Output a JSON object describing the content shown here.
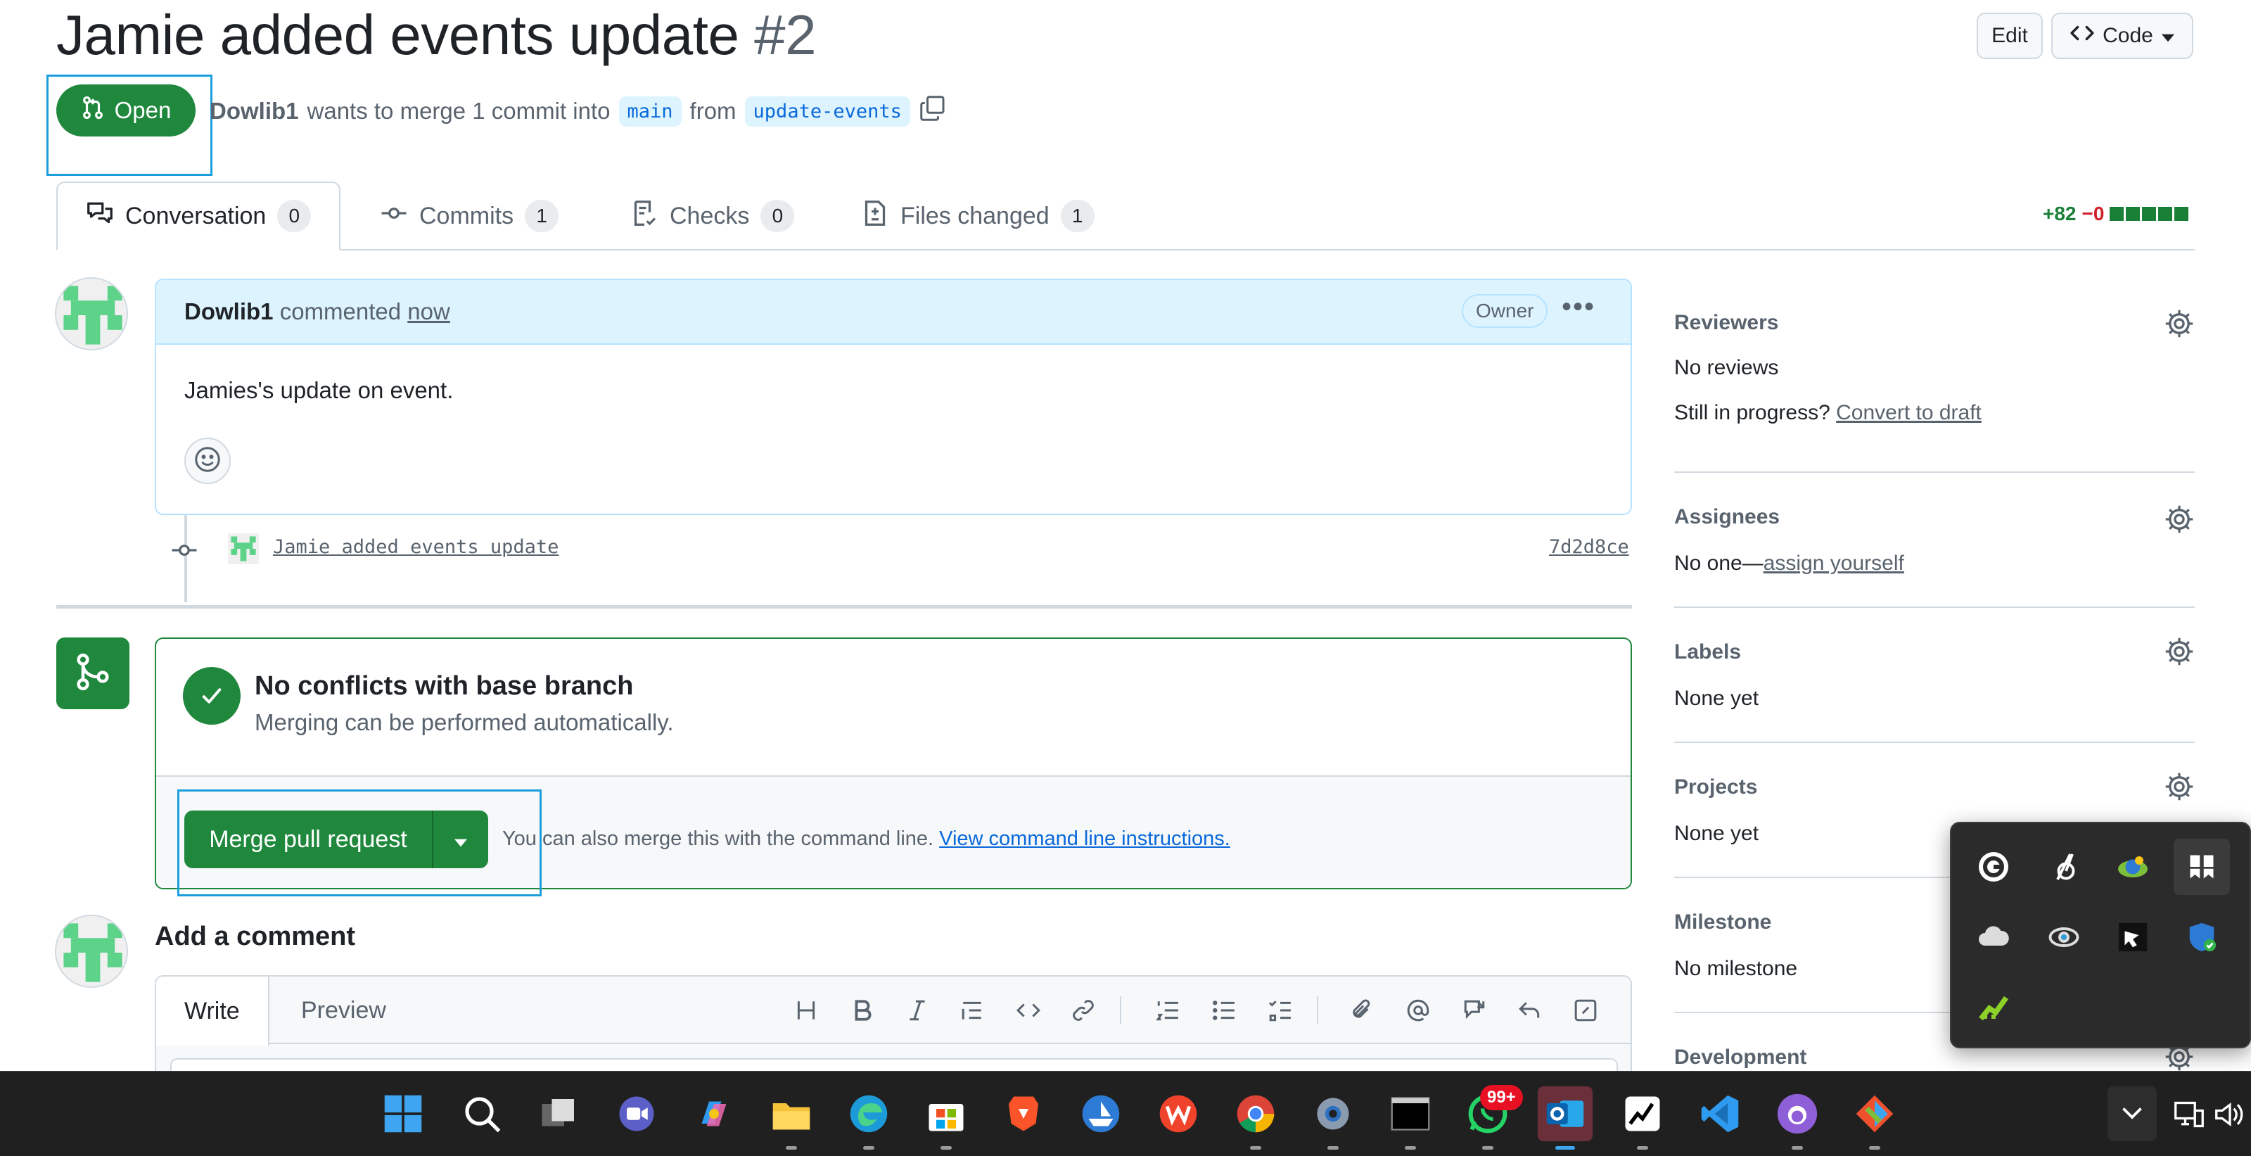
{
  "pr": {
    "title": "Jamie added events update",
    "number": "#2",
    "status": "Open",
    "author": "Dowlib1",
    "merge_text": "wants to merge 1 commit into",
    "base_branch": "main",
    "from_text": "from",
    "head_branch": "update-events"
  },
  "header": {
    "edit_label": "Edit",
    "code_label": "Code"
  },
  "tabs": [
    {
      "label": "Conversation",
      "count": "0",
      "active": true
    },
    {
      "label": "Commits",
      "count": "1"
    },
    {
      "label": "Checks",
      "count": "0"
    },
    {
      "label": "Files changed",
      "count": "1"
    }
  ],
  "diffstat": {
    "additions": "+82",
    "deletions": "−0"
  },
  "comment": {
    "author": "Dowlib1",
    "action": "commented",
    "time": "now",
    "role": "Owner",
    "body": "Jamies's update on event."
  },
  "commit": {
    "message": "Jamie added events update",
    "sha": "7d2d8ce"
  },
  "merge": {
    "title": "No conflicts with base branch",
    "subtitle": "Merging can be performed automatically.",
    "button": "Merge pull request",
    "hint": "You can also merge this with the command line.",
    "hint_link": "View command line instructions."
  },
  "add_comment": {
    "title": "Add a comment",
    "write_tab": "Write",
    "preview_tab": "Preview"
  },
  "sidebar": {
    "reviewers": {
      "label": "Reviewers",
      "value": "No reviews",
      "progress_q": "Still in progress?",
      "progress_link": "Convert to draft"
    },
    "assignees": {
      "label": "Assignees",
      "value": "No one—",
      "link": "assign yourself"
    },
    "labels": {
      "label": "Labels",
      "value": "None yet"
    },
    "projects": {
      "label": "Projects",
      "value": "None yet"
    },
    "milestone": {
      "label": "Milestone",
      "value": "No milestone"
    },
    "development": {
      "label": "Development"
    }
  },
  "taskbar": {
    "whatsapp_badge": "99+",
    "apps": [
      "start-icon",
      "search-icon",
      "task-view-icon",
      "meet-icon",
      "copilot-icon",
      "file-explorer-icon",
      "edge-icon",
      "store-icon",
      "brave-icon",
      "ship-icon",
      "wps-icon",
      "chrome-icon",
      "settings-icon",
      "terminal-icon",
      "whatsapp-icon",
      "outlook-icon",
      "stocks-icon",
      "vscode-icon",
      "github-icon",
      "git-icon"
    ]
  },
  "colors": {
    "green": "#1f883d",
    "blue_link": "#0969da",
    "highlight": "#1b9fdc"
  }
}
